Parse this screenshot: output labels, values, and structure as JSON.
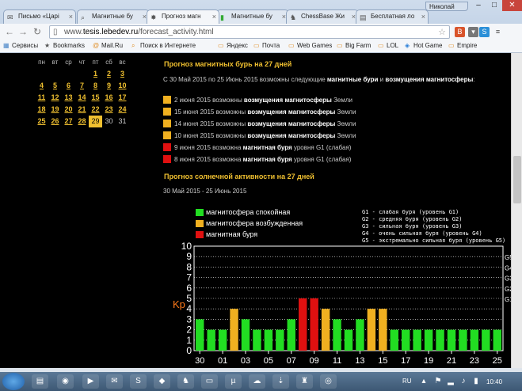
{
  "tabs": [
    {
      "label": "Письмо «Царі",
      "icon": "mail-icon"
    },
    {
      "label": "Магнитные бу",
      "icon": "search-icon"
    },
    {
      "label": "Прогноз магн",
      "icon": "tesis-icon"
    },
    {
      "label": "Магнитные бу",
      "icon": "chart-icon"
    },
    {
      "label": "ChessBase Жи",
      "icon": "chess-icon"
    },
    {
      "label": "Бесплатная ло",
      "icon": "doc-icon"
    }
  ],
  "user_badge": "Николай",
  "address": {
    "scheme": "www.",
    "host": "tesis.lebedev.ru",
    "path": "/forecast_activity.html"
  },
  "bookmarks": [
    "Сервисы",
    "Bookmarks",
    "Mail.Ru",
    "Поиск в Интернете",
    "Яндекс",
    "Почта",
    "Web Games",
    "Big Farm",
    "LOL",
    "Hot Game",
    "Empire"
  ],
  "calendar": {
    "weekdays": [
      "пн",
      "вт",
      "ср",
      "чт",
      "пт",
      "сб",
      "вс"
    ],
    "weeks": [
      [
        "",
        "",
        "",
        "",
        "1",
        "2",
        "3"
      ],
      [
        "4",
        "5",
        "6",
        "7",
        "8",
        "9",
        "10"
      ],
      [
        "11",
        "12",
        "13",
        "14",
        "15",
        "16",
        "17"
      ],
      [
        "18",
        "19",
        "20",
        "21",
        "22",
        "23",
        "24"
      ],
      [
        "25",
        "26",
        "27",
        "28",
        "29",
        "30",
        "31"
      ]
    ],
    "today": "29"
  },
  "forecast": {
    "title": "Прогноз магнитных бурь на 27 дней",
    "intro_prefix": "С 30 Май 2015 по 25 Июнь 2015 возможны следующие ",
    "intro_bold1": "магнитные бури",
    "intro_mid": " и ",
    "intro_bold2": "возмущения магнитосферы",
    "intro_suffix": ":",
    "events": [
      {
        "color": "#f0b020",
        "pre": "2 июня 2015 возможны ",
        "bold": "возмущения магнитосферы",
        "post": " Земли"
      },
      {
        "color": "#f0b020",
        "pre": "15 июня 2015 возможны ",
        "bold": "возмущения магнитосферы",
        "post": " Земли"
      },
      {
        "color": "#f0b020",
        "pre": "14 июня 2015 возможны ",
        "bold": "возмущения магнитосферы",
        "post": " Земли"
      },
      {
        "color": "#f0b020",
        "pre": "10 июня 2015 возможны ",
        "bold": "возмущения магнитосферы",
        "post": " Земли"
      },
      {
        "color": "#e01010",
        "pre": "9 июня 2015 возможна ",
        "bold": "магнитная буря",
        "post": " уровня G1 (слабая)"
      },
      {
        "color": "#e01010",
        "pre": "8 июня 2015 возможна ",
        "bold": "магнитная буря",
        "post": " уровня G1 (слабая)"
      }
    ]
  },
  "solar": {
    "title": "Прогноз солнечной активности на 27 дней",
    "range": "30 Май 2015 - 25 Июнь 2015"
  },
  "legend": [
    {
      "color": "#22dd22",
      "label": "магнитосфера спокойная"
    },
    {
      "color": "#f0b020",
      "label": "магнитосфера возбужденная"
    },
    {
      "color": "#e01010",
      "label": "магнитная буря"
    }
  ],
  "g_legend": [
    "G1 - слабая буря (уровень G1)",
    "G2 - средняя буря (уровень G2)",
    "G3 - сильная буря (уровень G3)",
    "G4 - очень сильная буря (уровень G4)",
    "G5 - экстремально сильная буря (уровень G5)"
  ],
  "chart_data": {
    "type": "bar",
    "ylabel": "Kp",
    "ylim": [
      0,
      10
    ],
    "yticks": [
      "0",
      "1",
      "2",
      "3",
      "4",
      "5",
      "6",
      "7",
      "8",
      "9",
      "10"
    ],
    "right_labels": [
      "G5",
      "G4",
      "G3",
      "G2",
      "G1"
    ],
    "x_tick_labels": [
      "30",
      "01",
      "03",
      "05",
      "07",
      "09",
      "11",
      "13",
      "15",
      "17",
      "19",
      "21",
      "23",
      "25"
    ],
    "caption": "30 мая 2015 - 25 июня 2015",
    "values": [
      3,
      2,
      2,
      4,
      3,
      2,
      2,
      2,
      3,
      5,
      5,
      4,
      3,
      2,
      3,
      4,
      4,
      2,
      2,
      2,
      2,
      2,
      2,
      2,
      2,
      2,
      2
    ],
    "colors": {
      "calm": "#22dd22",
      "excited": "#f0b020",
      "storm": "#e01010"
    },
    "levels": [
      "calm",
      "calm",
      "calm",
      "excited",
      "calm",
      "calm",
      "calm",
      "calm",
      "calm",
      "storm",
      "storm",
      "excited",
      "calm",
      "calm",
      "calm",
      "excited",
      "excited",
      "calm",
      "calm",
      "calm",
      "calm",
      "calm",
      "calm",
      "calm",
      "calm",
      "calm",
      "calm"
    ]
  },
  "taskbar": {
    "lang": "RU",
    "clock": "10:40"
  }
}
